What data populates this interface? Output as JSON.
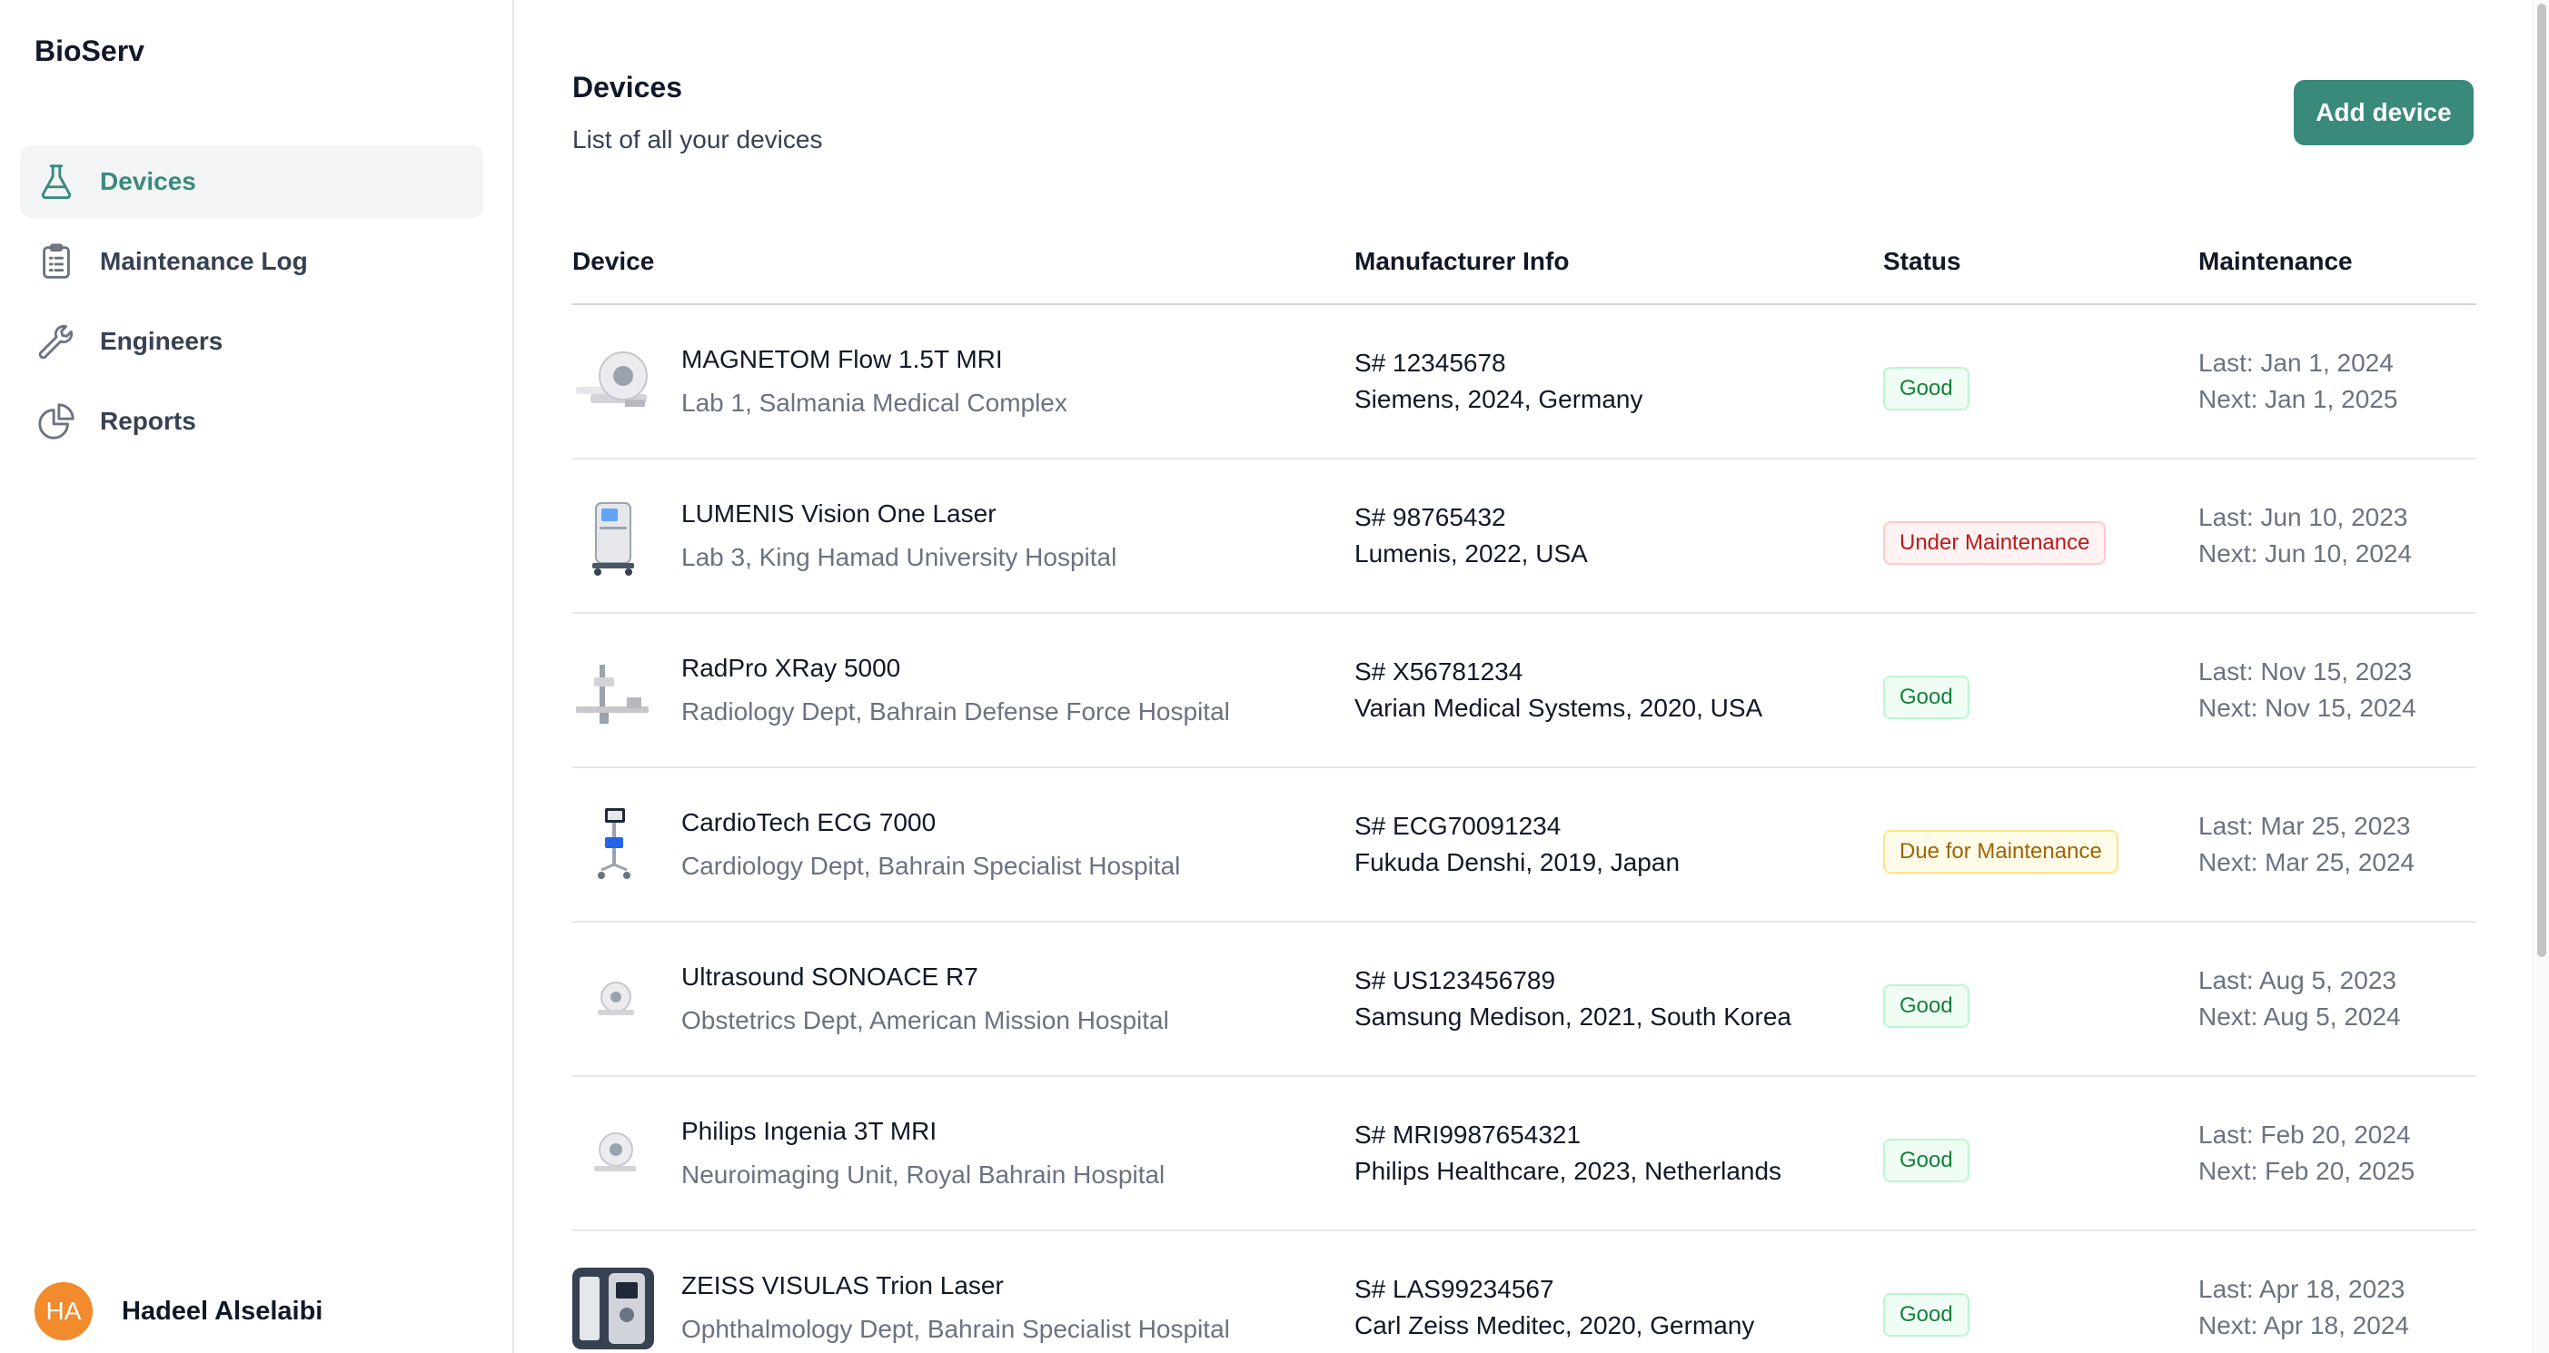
{
  "app": {
    "brand": "BioServ"
  },
  "sidebar": {
    "items": [
      {
        "label": "Devices",
        "icon": "flask-icon",
        "active": true
      },
      {
        "label": "Maintenance Log",
        "icon": "clipboard-icon",
        "active": false
      },
      {
        "label": "Engineers",
        "icon": "wrench-icon",
        "active": false
      },
      {
        "label": "Reports",
        "icon": "pie-chart-icon",
        "active": false
      }
    ],
    "user": {
      "initials": "HA",
      "name": "Hadeel Alselaibi"
    }
  },
  "page": {
    "title": "Devices",
    "subtitle": "List of all your devices",
    "add_button": "Add device"
  },
  "table": {
    "headers": [
      "Device",
      "Manufacturer Info",
      "Status",
      "Maintenance"
    ],
    "rows": [
      {
        "name": "MAGNETOM Flow 1.5T MRI",
        "location": "Lab 1, Salmania Medical Complex",
        "serial": "S# 12345678",
        "manufacturer": "Siemens, 2024, Germany",
        "status": "Good",
        "status_kind": "good",
        "last": "Last: Jan 1, 2024",
        "next": "Next: Jan 1, 2025",
        "thumb": "mri-scanner"
      },
      {
        "name": "LUMENIS Vision One Laser",
        "location": "Lab 3, King Hamad University Hospital",
        "serial": "S# 98765432",
        "manufacturer": "Lumenis, 2022, USA",
        "status": "Under Maintenance",
        "status_kind": "under",
        "last": "Last: Jun 10, 2023",
        "next": "Next: Jun 10, 2024",
        "thumb": "laser-cabinet"
      },
      {
        "name": "RadPro XRay 5000",
        "location": "Radiology Dept, Bahrain Defense Force Hospital",
        "serial": "S# X56781234",
        "manufacturer": "Varian Medical Systems, 2020, USA",
        "status": "Good",
        "status_kind": "good",
        "last": "Last: Nov 15, 2023",
        "next": "Next: Nov 15, 2024",
        "thumb": "xray-table"
      },
      {
        "name": "CardioTech ECG 7000",
        "location": "Cardiology Dept, Bahrain Specialist Hospital",
        "serial": "S# ECG70091234",
        "manufacturer": "Fukuda Denshi, 2019, Japan",
        "status": "Due for Maintenance",
        "status_kind": "due",
        "last": "Last: Mar 25, 2023",
        "next": "Next: Mar 25, 2024",
        "thumb": "ecg-cart"
      },
      {
        "name": "Ultrasound SONOACE R7",
        "location": "Obstetrics Dept, American Mission Hospital",
        "serial": "S# US123456789",
        "manufacturer": "Samsung Medison, 2021, South Korea",
        "status": "Good",
        "status_kind": "good",
        "last": "Last: Aug 5, 2023",
        "next": "Next: Aug 5, 2024",
        "thumb": "small-scanner"
      },
      {
        "name": "Philips Ingenia 3T MRI",
        "location": "Neuroimaging Unit, Royal Bahrain Hospital",
        "serial": "S# MRI9987654321",
        "manufacturer": "Philips Healthcare, 2023, Netherlands",
        "status": "Good",
        "status_kind": "good",
        "last": "Last: Feb 20, 2024",
        "next": "Next: Feb 20, 2025",
        "thumb": "small-scanner"
      },
      {
        "name": "ZEISS VISULAS Trion Laser",
        "location": "Ophthalmology Dept, Bahrain Specialist Hospital",
        "serial": "S# LAS99234567",
        "manufacturer": "Carl Zeiss Meditec, 2020, Germany",
        "status": "Good",
        "status_kind": "good",
        "last": "Last: Apr 18, 2023",
        "next": "Next: Apr 18, 2024",
        "thumb": "ophthalmic-laser"
      }
    ]
  },
  "colors": {
    "accent": "#3a8a7c",
    "avatar": "#f28a2e",
    "good": "#15803d",
    "under": "#b91c1c",
    "due": "#a16207"
  }
}
